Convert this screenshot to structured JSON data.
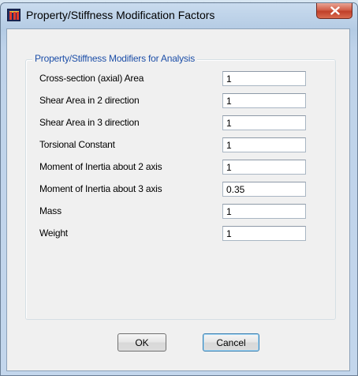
{
  "window": {
    "title": "Property/Stiffness Modification Factors",
    "app_icon": "etabs-app-icon",
    "close_icon": "close-x-icon",
    "accent_close": "#c7432c"
  },
  "group": {
    "legend": "Property/Stiffness Modifiers for Analysis"
  },
  "rows": [
    {
      "label": "Cross-section (axial) Area",
      "value": "1"
    },
    {
      "label": "Shear Area in 2 direction",
      "value": "1"
    },
    {
      "label": "Shear Area in 3 direction",
      "value": "1"
    },
    {
      "label": "Torsional Constant",
      "value": "1"
    },
    {
      "label": "Moment of Inertia about 2 axis",
      "value": "1"
    },
    {
      "label": "Moment of Inertia about 3 axis",
      "value": "0.35"
    },
    {
      "label": "Mass",
      "value": "1"
    },
    {
      "label": "Weight",
      "value": "1"
    }
  ],
  "buttons": {
    "ok_label": "OK",
    "cancel_label": "Cancel"
  }
}
